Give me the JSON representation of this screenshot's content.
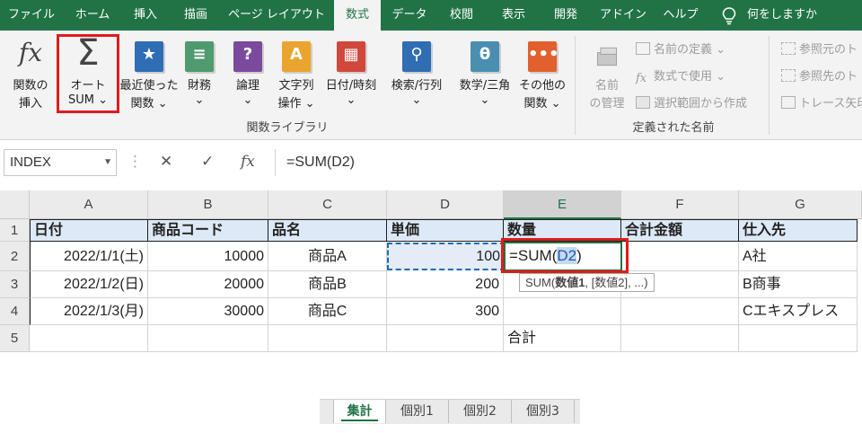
{
  "ribbon_tabs": [
    "ファイル",
    "ホーム",
    "挿入",
    "描画",
    "ページ レイアウト",
    "数式",
    "データ",
    "校閲",
    "表示",
    "開発",
    "アドイン",
    "ヘルプ",
    "何をしますか"
  ],
  "ribbon_tab_active": "数式",
  "function_library": {
    "buttons": [
      {
        "line1": "関数の",
        "line2": "挿入"
      },
      {
        "line1": "オート",
        "line2": "SUM ⌄"
      },
      {
        "line1": "最近使った",
        "line2": "関数 ⌄"
      },
      {
        "line1": "財務",
        "line2": "⌄"
      },
      {
        "line1": "論理",
        "line2": "⌄"
      },
      {
        "line1": "文字列",
        "line2": "操作 ⌄"
      },
      {
        "line1": "日付/時刻",
        "line2": "⌄"
      },
      {
        "line1": "検索/行列",
        "line2": "⌄"
      },
      {
        "line1": "数学/三角",
        "line2": "⌄"
      },
      {
        "line1": "その他の",
        "line2": "関数 ⌄"
      }
    ],
    "group_label": "関数ライブラリ"
  },
  "defined_names": {
    "name_manager": {
      "line1": "名前",
      "line2": "の管理"
    },
    "define_name": "名前の定義 ⌄",
    "use_in_formula": "数式で使用 ⌄",
    "create_from_selection": "選択範囲から作成",
    "group_label": "定義された名前"
  },
  "formula_auditing": {
    "trace_precedents": "参照元のト",
    "trace_dependents": "参照先のト",
    "remove_arrows": "トレース矢印"
  },
  "formula_bar": {
    "name_box": "INDEX",
    "formula": "=SUM(D2)"
  },
  "columns": [
    "A",
    "B",
    "C",
    "D",
    "E",
    "F",
    "G"
  ],
  "selected_column": "E",
  "rows": [
    "1",
    "2",
    "3",
    "4",
    "5"
  ],
  "table": {
    "headers": [
      "日付",
      "商品コード",
      "品名",
      "単価",
      "数量",
      "合計金額",
      "仕入先"
    ],
    "data": [
      [
        "2022/1/1(土)",
        "10000",
        "商品A",
        "100",
        "",
        "",
        "A社"
      ],
      [
        "2022/1/2(日)",
        "20000",
        "商品B",
        "200",
        "",
        "",
        "B商事"
      ],
      [
        "2022/1/3(月)",
        "30000",
        "商品C",
        "300",
        "",
        "",
        "Cエキスプレス"
      ]
    ],
    "total_label": "合計"
  },
  "editing_cell": {
    "prefix": "=SUM(",
    "ref": "D2",
    "suffix": ")"
  },
  "tooltip": {
    "func": "SUM(",
    "bold_arg": "数値1",
    "rest": ", [数値2], ...)"
  },
  "sheet_tabs": [
    "集計",
    "個別1",
    "個別2",
    "個別3"
  ],
  "active_sheet": "集計",
  "colors": {
    "accent": "#217346",
    "highlight": "#e01b1b",
    "header_fill": "#dde9f6"
  }
}
